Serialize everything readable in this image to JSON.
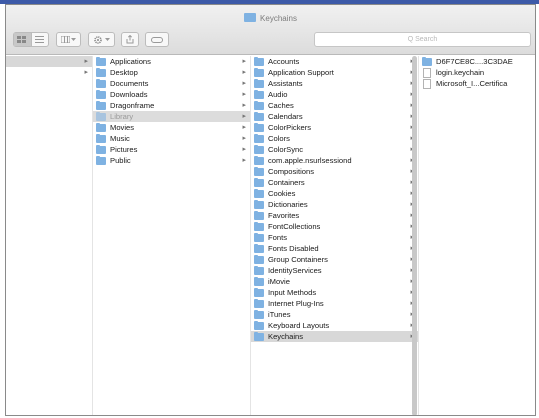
{
  "window": {
    "title": "Keychains",
    "search_placeholder": "Q Search"
  },
  "sidebar": {
    "rows": [
      "",
      ""
    ]
  },
  "columns": [
    {
      "name": "home",
      "items": [
        {
          "label": "Applications",
          "folder": true,
          "arrow": true
        },
        {
          "label": "Desktop",
          "folder": true,
          "arrow": true
        },
        {
          "label": "Documents",
          "folder": true,
          "arrow": true
        },
        {
          "label": "Downloads",
          "folder": true,
          "arrow": true
        },
        {
          "label": "Dragonframe",
          "folder": true,
          "arrow": true
        },
        {
          "label": "Library",
          "folder": true,
          "arrow": true,
          "selected": true
        },
        {
          "label": "Movies",
          "folder": true,
          "arrow": true
        },
        {
          "label": "Music",
          "folder": true,
          "arrow": true
        },
        {
          "label": "Pictures",
          "folder": true,
          "arrow": true
        },
        {
          "label": "Public",
          "folder": true,
          "arrow": true
        }
      ]
    },
    {
      "name": "library",
      "items": [
        {
          "label": "Accounts",
          "folder": true,
          "arrow": true
        },
        {
          "label": "Application Support",
          "folder": true,
          "arrow": true
        },
        {
          "label": "Assistants",
          "folder": true,
          "arrow": true
        },
        {
          "label": "Audio",
          "folder": true,
          "arrow": true
        },
        {
          "label": "Caches",
          "folder": true,
          "arrow": true
        },
        {
          "label": "Calendars",
          "folder": true,
          "arrow": true
        },
        {
          "label": "ColorPickers",
          "folder": true,
          "arrow": true
        },
        {
          "label": "Colors",
          "folder": true,
          "arrow": true
        },
        {
          "label": "ColorSync",
          "folder": true,
          "arrow": true
        },
        {
          "label": "com.apple.nsurlsessiond",
          "folder": true,
          "arrow": true
        },
        {
          "label": "Compositions",
          "folder": true,
          "arrow": true
        },
        {
          "label": "Containers",
          "folder": true,
          "arrow": true
        },
        {
          "label": "Cookies",
          "folder": true,
          "arrow": true
        },
        {
          "label": "Dictionaries",
          "folder": true,
          "arrow": true
        },
        {
          "label": "Favorites",
          "folder": true,
          "arrow": true
        },
        {
          "label": "FontCollections",
          "folder": true,
          "arrow": true
        },
        {
          "label": "Fonts",
          "folder": true,
          "arrow": true
        },
        {
          "label": "Fonts Disabled",
          "folder": true,
          "arrow": true
        },
        {
          "label": "Group Containers",
          "folder": true,
          "arrow": true
        },
        {
          "label": "IdentityServices",
          "folder": true,
          "arrow": true
        },
        {
          "label": "iMovie",
          "folder": true,
          "arrow": true
        },
        {
          "label": "Input Methods",
          "folder": true,
          "arrow": true
        },
        {
          "label": "Internet Plug-Ins",
          "folder": true,
          "arrow": true
        },
        {
          "label": "iTunes",
          "folder": true,
          "arrow": true
        },
        {
          "label": "Keyboard Layouts",
          "folder": true,
          "arrow": true
        },
        {
          "label": "Keychains",
          "folder": true,
          "arrow": true,
          "selected": true
        }
      ]
    },
    {
      "name": "keychains",
      "items": [
        {
          "label": "D6F7CE8C....3C3DAE",
          "folder": true,
          "arrow": false
        },
        {
          "label": "login.keychain",
          "folder": false,
          "arrow": false
        },
        {
          "label": "Microsoft_I...Certifica",
          "folder": false,
          "arrow": false
        }
      ]
    }
  ],
  "icons": {
    "folder_color": "#7fb2e2",
    "arrow": "▸"
  }
}
